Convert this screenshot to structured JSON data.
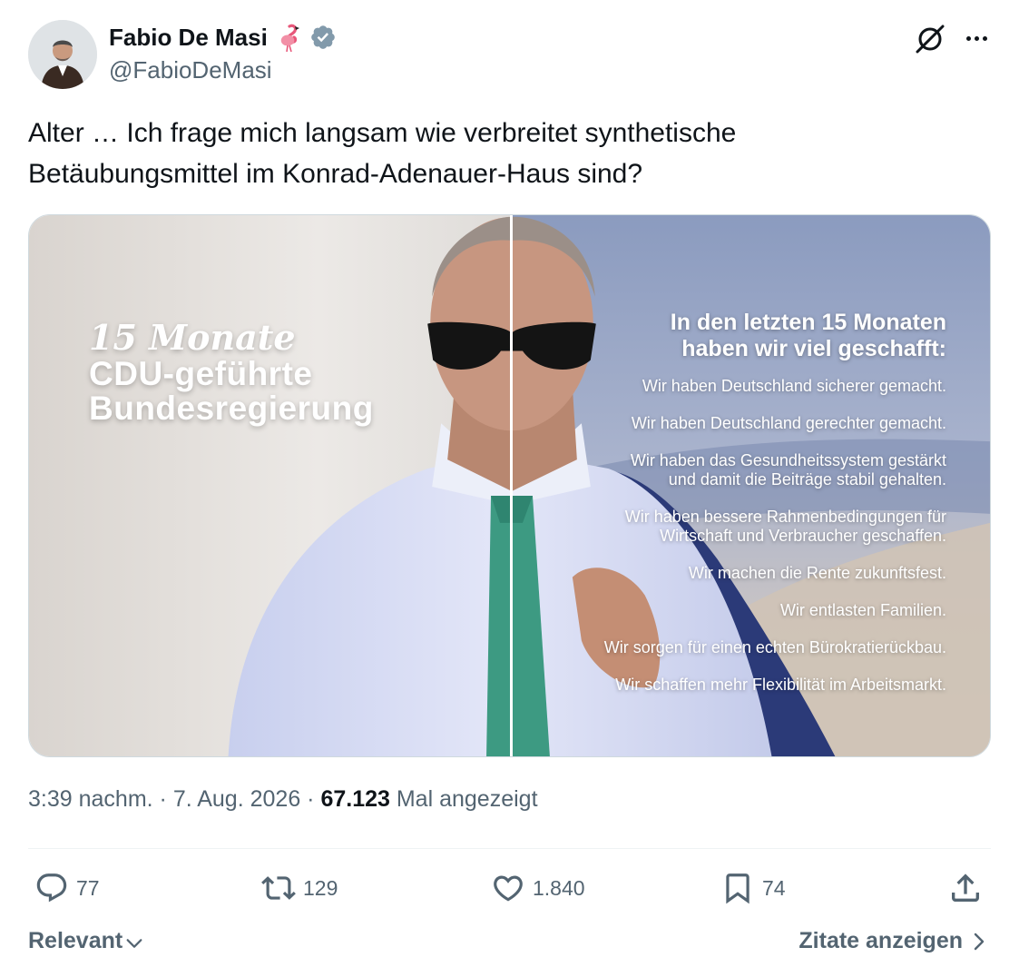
{
  "author": {
    "display_name": "Fabio De Masi",
    "handle": "@FabioDeMasi",
    "emoji_icon": "flamingo-icon",
    "verified_color": "#829aab"
  },
  "tweet": {
    "text_lines": [
      "Alter … Ich frage mich langsam wie verbreitet synthetische",
      "Betäubungsmittel im Konrad-Adenauer-Haus sind?"
    ]
  },
  "media": {
    "left_caption_italic": "15 Monate",
    "left_caption_lines": [
      "CDU-geführte",
      "Bundesregierung"
    ],
    "right_heading_lines": [
      "In den letzten 15 Monaten",
      "haben wir viel geschafft:"
    ],
    "right_items": [
      "Wir haben  Deutschland sicherer gemacht.",
      "Wir haben Deutschland gerechter gemacht.",
      "Wir haben das Gesundheitssystem gestärkt\nund damit die Beiträge stabil gehalten.",
      "Wir haben bessere Rahmenbedingungen für\nWirtschaft und Verbraucher geschaffen.",
      "Wir machen die Rente zukunftsfest.",
      "Wir entlasten Familien.",
      "Wir sorgen für einen echten Bürokratierückbau.",
      "Wir schaffen mehr Flexibilität im Arbeitsmarkt."
    ]
  },
  "meta": {
    "time": "3:39 nachm.",
    "separator": " · ",
    "date": "7. Aug. 2026",
    "views": "67.123",
    "views_label": "Mal angezeigt"
  },
  "actions": {
    "replies": "77",
    "reposts": "129",
    "likes": "1.840",
    "bookmarks": "74"
  },
  "footer": {
    "sort_label": "Relevant",
    "quotes_label": "Zitate anzeigen"
  },
  "colors": {
    "text_primary": "#0f1419",
    "text_secondary": "#536471",
    "divider": "#eff3f4"
  }
}
